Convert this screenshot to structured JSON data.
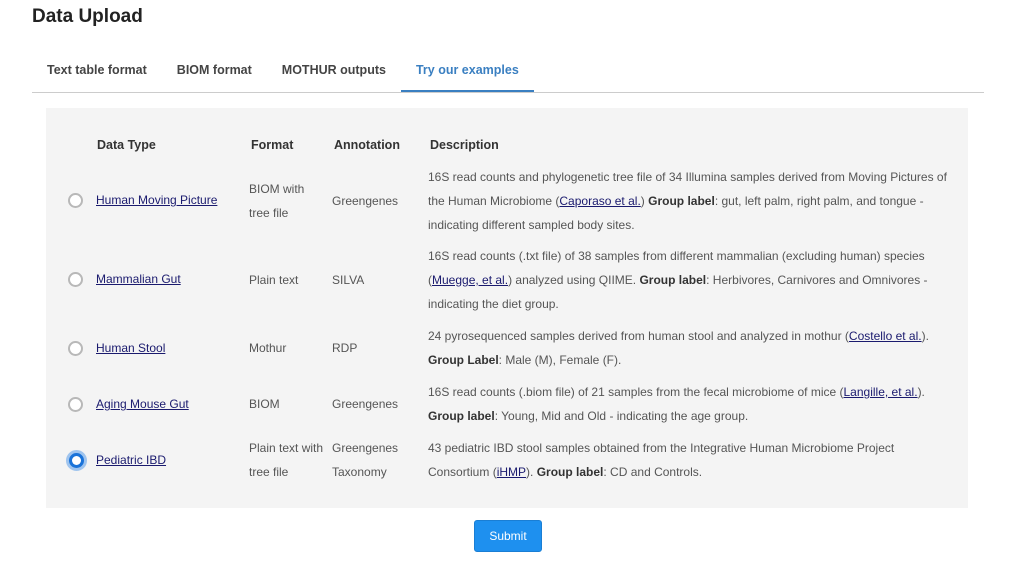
{
  "page": {
    "title": "Data Upload"
  },
  "tabs": [
    {
      "label": "Text table format",
      "active": false
    },
    {
      "label": "BIOM format",
      "active": false
    },
    {
      "label": "MOTHUR outputs",
      "active": false
    },
    {
      "label": "Try our examples",
      "active": true
    }
  ],
  "table": {
    "headers": {
      "data_type": "Data Type",
      "format": "Format",
      "annotation": "Annotation",
      "description": "Description"
    },
    "rows": [
      {
        "name": "Human Moving Picture",
        "format_lines": [
          "BIOM with",
          "tree file"
        ],
        "annotation_lines": [
          "Greengenes"
        ],
        "selected": false,
        "desc": {
          "pre": "16S read counts and phylogenetic tree file of 34 Illumina samples derived from Moving Pictures of the Human Microbiome (",
          "link": "Caporaso et al.",
          "mid": ") ",
          "label": "Group label",
          "post": ": gut, left palm, right palm, and tongue - indicating different sampled body sites."
        }
      },
      {
        "name": "Mammalian Gut",
        "format_lines": [
          "Plain text"
        ],
        "annotation_lines": [
          "SILVA"
        ],
        "selected": false,
        "desc": {
          "pre": "16S read counts (.txt file) of 38 samples from different mammalian (excluding human) species (",
          "link": "Muegge, et al.",
          "mid": ") analyzed using QIIME. ",
          "label": "Group label",
          "post": ": Herbivores, Carnivores and Omnivores - indicating the diet group."
        }
      },
      {
        "name": "Human Stool",
        "format_lines": [
          "Mothur"
        ],
        "annotation_lines": [
          "RDP"
        ],
        "selected": false,
        "desc": {
          "pre": "24 pyrosequenced samples derived from human stool and analyzed in mothur (",
          "link": "Costello et al.",
          "mid": "). ",
          "label": "Group Label",
          "post": ": Male (M), Female (F)."
        }
      },
      {
        "name": "Aging Mouse Gut",
        "format_lines": [
          "BIOM"
        ],
        "annotation_lines": [
          "Greengenes"
        ],
        "selected": false,
        "desc": {
          "pre": "16S read counts (.biom file) of 21 samples from the fecal microbiome of mice (",
          "link": "Langille, et al.",
          "mid": "). ",
          "label": "Group label",
          "post": ": Young, Mid and Old - indicating the age group."
        }
      },
      {
        "name": "Pediatric IBD",
        "format_lines": [
          "Plain text with",
          "tree file"
        ],
        "annotation_lines": [
          "Greengenes",
          "Taxonomy"
        ],
        "selected": true,
        "desc": {
          "pre": "43 pediatric IBD stool samples obtained from the Integrative Human Microbiome Project Consortium (",
          "link": "iHMP",
          "mid": "). ",
          "label": "Group label",
          "post": ": CD and Controls."
        }
      }
    ]
  },
  "submit_label": "Submit",
  "colors": {
    "accent": "#3a7fc1",
    "button": "#1e90ef",
    "link": "#1a1a6e",
    "panel_bg": "#f4f4f4"
  }
}
